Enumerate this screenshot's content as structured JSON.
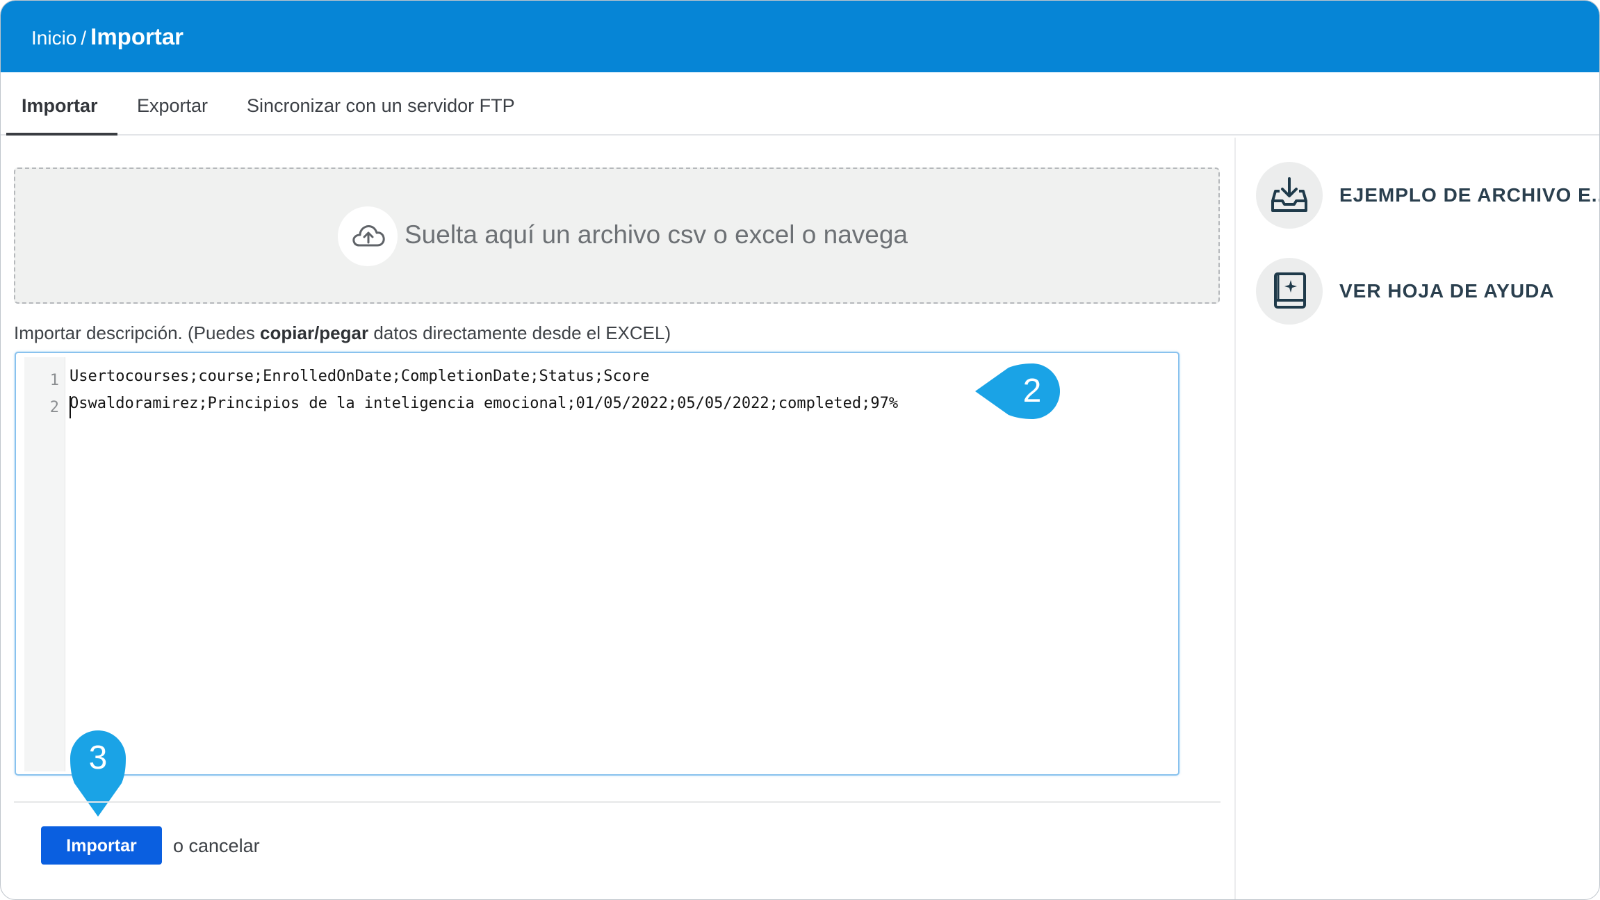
{
  "breadcrumb": {
    "home": "Inicio",
    "separator": "/",
    "current": "Importar"
  },
  "tabs": [
    {
      "label": "Importar",
      "active": true
    },
    {
      "label": "Exportar",
      "active": false
    },
    {
      "label": "Sincronizar con un servidor FTP",
      "active": false
    }
  ],
  "dropzone": {
    "text": "Suelta aquí un archivo csv o excel o navega",
    "icon": "cloud-upload-icon"
  },
  "description": {
    "prefix": "Importar descripción. (Puedes ",
    "bold": "copiar/pegar",
    "suffix": " datos directamente desde el EXCEL)"
  },
  "editor": {
    "lines": [
      {
        "num": "1",
        "text": "Usertocourses;course;EnrolledOnDate;CompletionDate;Status;Score"
      },
      {
        "num": "2",
        "text": "Oswaldoramirez;Principios de la inteligencia emocional;01/05/2022;05/05/2022;completed;97%"
      }
    ]
  },
  "callouts": {
    "step2": "2",
    "step3": "3",
    "color": "#1aa3e6"
  },
  "side_actions": [
    {
      "label": "EJEMPLO DE ARCHIVO E...",
      "icon": "download-tray-icon"
    },
    {
      "label": "VER HOJA DE AYUDA",
      "icon": "help-book-icon"
    }
  ],
  "footer": {
    "import_label": "Importar",
    "cancel_label": "o cancelar"
  },
  "colors": {
    "topbar": "#0685d6",
    "import_button": "#0a5fe0",
    "icon_dark": "#1f3a4a"
  }
}
